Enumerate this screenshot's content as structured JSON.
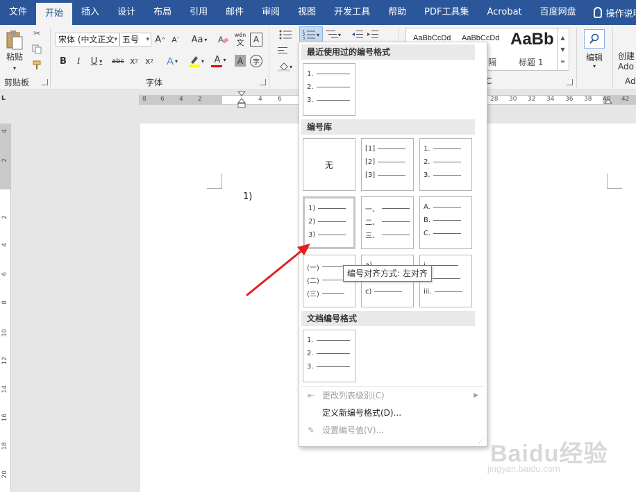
{
  "tabs": [
    "文件",
    "开始",
    "插入",
    "设计",
    "布局",
    "引用",
    "邮件",
    "审阅",
    "视图",
    "开发工具",
    "帮助",
    "PDF工具集",
    "Acrobat",
    "百度网盘"
  ],
  "active_tab": "开始",
  "tell_me": "操作说明搜",
  "ribbon": {
    "clipboard": {
      "paste": "粘贴",
      "label": "剪贴板"
    },
    "font": {
      "name": "宋体 (中文正文",
      "size": "五号",
      "label": "字体",
      "aa": "Aa",
      "wen": "wén",
      "wen_char": "文",
      "zi": "字",
      "aicon": "A"
    },
    "styles": {
      "sample1": "AaBbCcDd",
      "sample2": "AaBbCcDd",
      "sample3": "AaBb",
      "name2": "隔",
      "name3": "标题 1",
      "label_fragment": "C"
    },
    "editing": {
      "label": "编辑"
    },
    "create": {
      "line1": "创建",
      "line2": "Ado",
      "label": "Ad"
    }
  },
  "ruler": {
    "h_left": [
      "8",
      "6",
      "4",
      "2"
    ],
    "h_mid": [
      "4",
      "6"
    ],
    "h_right": [
      "28",
      "30",
      "32",
      "34",
      "36",
      "38",
      "40",
      "42"
    ],
    "corner": "L",
    "v": [
      "4",
      "2",
      "2",
      "4",
      "6",
      "8",
      "10",
      "12",
      "14",
      "16",
      "18",
      "20"
    ]
  },
  "document": {
    "line1": "1)"
  },
  "dropdown": {
    "recent_title": "最近使用过的编号格式",
    "library_title": "编号库",
    "doc_title": "文档编号格式",
    "none_label": "无",
    "recent_tile": [
      "1.",
      "2.",
      "3."
    ],
    "library": [
      {
        "name": "none"
      },
      {
        "name": "bracket-numbers",
        "rows": [
          "[1]",
          "[2]",
          "[3]"
        ]
      },
      {
        "name": "dot-numbers",
        "rows": [
          "1.",
          "2.",
          "3."
        ]
      },
      {
        "name": "paren-numbers",
        "rows": [
          "1)",
          "2)",
          "3)"
        ]
      },
      {
        "name": "chinese-numbers",
        "rows": [
          "一、",
          "二、",
          "三、"
        ]
      },
      {
        "name": "upper-letters",
        "rows": [
          "A.",
          "B.",
          "C."
        ]
      },
      {
        "name": "chinese-paren",
        "rows": [
          "(一)",
          "(二)",
          "(三)"
        ]
      },
      {
        "name": "lower-letters",
        "rows": [
          "a)",
          "b)",
          "c)"
        ]
      },
      {
        "name": "lower-roman",
        "rows": [
          "i.",
          "ii.",
          "iii."
        ]
      }
    ],
    "doc_tile": [
      "1.",
      "2.",
      "3."
    ],
    "menu": {
      "change_level": "更改列表级别(C)",
      "define_new": "定义新编号格式(D)...",
      "set_value": "设置编号值(V)..."
    }
  },
  "tooltip": "编号对齐方式: 左对齐",
  "watermark": {
    "brand": "Baidu经验",
    "url": "jingyan.baidu.com"
  },
  "colors": {
    "ribbon_blue": "#2b579a",
    "highlight": "#ffff00",
    "font_red": "#e00000",
    "arrow_red": "#e02020"
  }
}
